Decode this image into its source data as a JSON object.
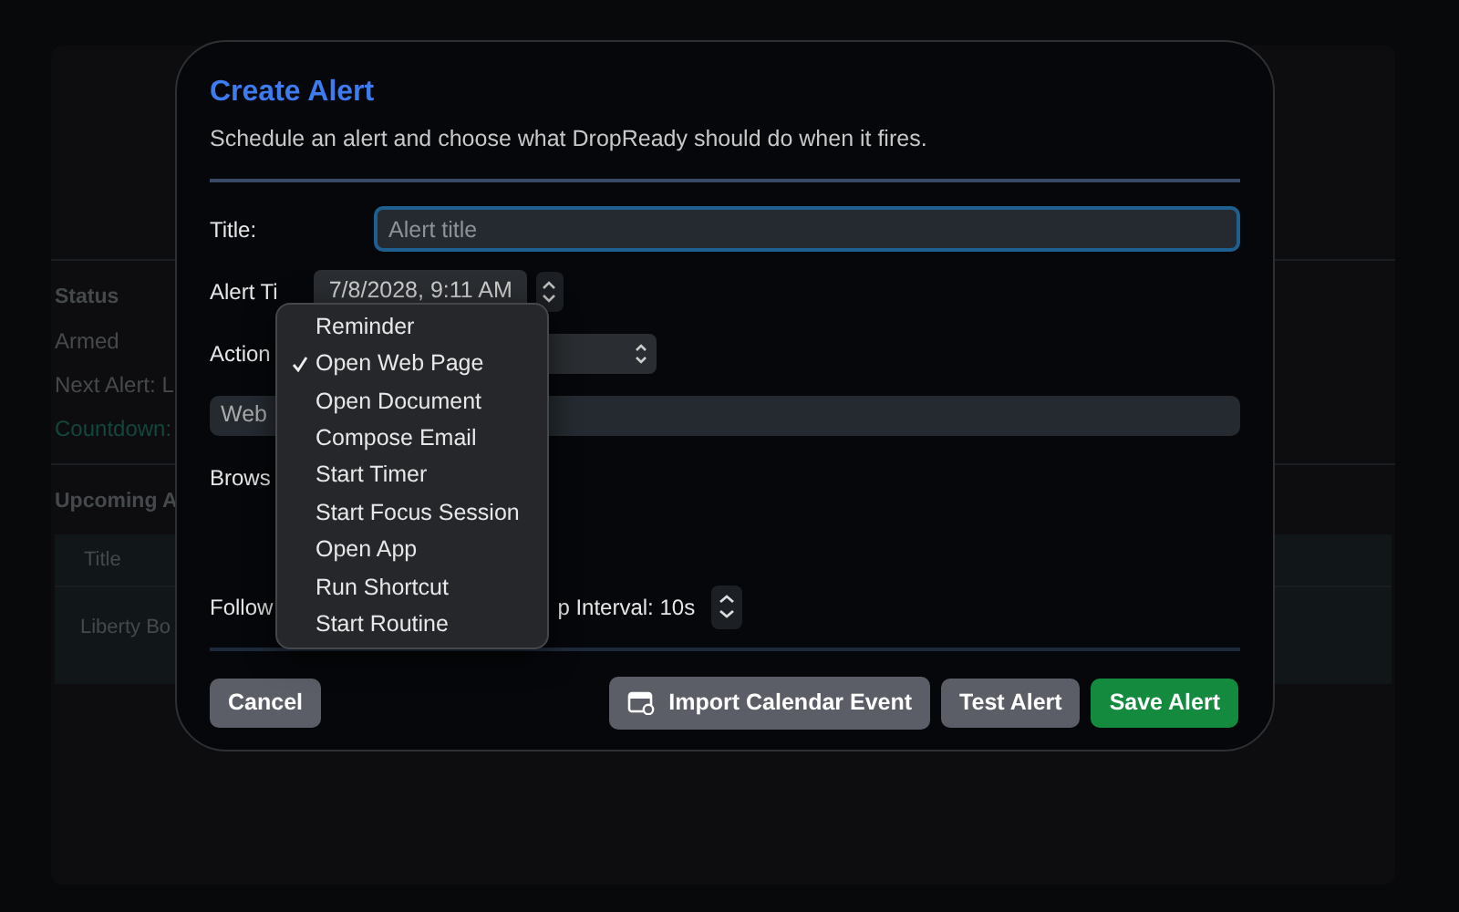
{
  "background": {
    "status_heading": "Status",
    "status": "Armed",
    "next_alert": "Next Alert: L",
    "countdown": "Countdown:",
    "upcoming_heading": "Upcoming A",
    "table": {
      "columns": [
        "Title"
      ],
      "rows": [
        [
          "Liberty Bo"
        ]
      ]
    }
  },
  "dialog": {
    "title": "Create Alert",
    "subtitle": "Schedule an alert and choose what DropReady should do when it fires.",
    "title_field": {
      "label": "Title:",
      "placeholder": "Alert title",
      "focused": true
    },
    "alert_time_label": "Alert Ti",
    "alert_time_value": "7/8/2028, 9:11 AM",
    "action_label": "Action",
    "web_field": {
      "value": "Web"
    },
    "browser_label": "Brows",
    "follow_label": "Follow",
    "interval": "p Interval: 10s"
  },
  "menu": {
    "items": [
      {
        "label": "Reminder",
        "selected": false
      },
      {
        "label": "Open Web Page",
        "selected": true
      },
      {
        "label": "Open Document",
        "selected": false
      },
      {
        "label": "Compose Email",
        "selected": false
      },
      {
        "label": "Start Timer",
        "selected": false
      },
      {
        "label": "Start Focus Session",
        "selected": false
      },
      {
        "label": "Open App",
        "selected": false
      },
      {
        "label": "Run Shortcut",
        "selected": false
      },
      {
        "label": "Start Routine",
        "selected": false
      }
    ]
  },
  "buttons": [
    {
      "label": "Cancel",
      "kind": "secondary"
    },
    {
      "label": "Import Calendar Event",
      "kind": "calendar"
    },
    {
      "label": "Test Alert",
      "kind": "secondary"
    },
    {
      "label": "Save Alert",
      "kind": "success"
    }
  ]
}
